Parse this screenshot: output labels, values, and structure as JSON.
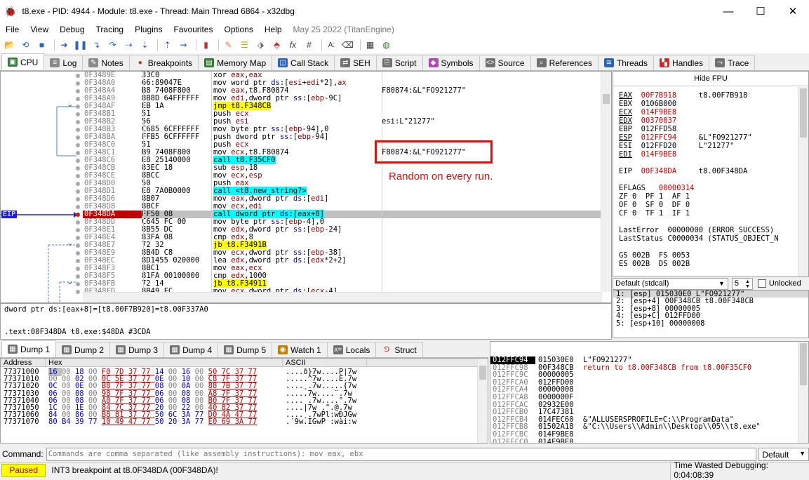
{
  "window": {
    "title": "t8.exe - PID: 4944 - Module: t8.exe - Thread: Main Thread 6864 - x32dbg"
  },
  "menu": [
    "File",
    "View",
    "Debug",
    "Tracing",
    "Plugins",
    "Favourites",
    "Options",
    "Help"
  ],
  "menu_date": "May 25 2022 (TitanEngine)",
  "tabs": [
    {
      "label": "CPU",
      "icon": "cpu-icon",
      "color": "#3a7a3a"
    },
    {
      "label": "Log",
      "icon": "log-icon",
      "color": "#6b6b6b"
    },
    {
      "label": "Notes",
      "icon": "notes-icon",
      "color": "#6b6b6b"
    },
    {
      "label": "Breakpoints",
      "icon": "breakpoint-icon",
      "color": "#d02020"
    },
    {
      "label": "Memory Map",
      "icon": "memory-map-icon",
      "color": "#2f7a2f"
    },
    {
      "label": "Call Stack",
      "icon": "call-stack-icon",
      "color": "#2a63b8"
    },
    {
      "label": "SEH",
      "icon": "seh-icon",
      "color": "#555"
    },
    {
      "label": "Script",
      "icon": "script-icon",
      "color": "#555"
    },
    {
      "label": "Symbols",
      "icon": "symbols-icon",
      "color": "#b04ab0"
    },
    {
      "label": "Source",
      "icon": "source-icon",
      "color": "#555"
    },
    {
      "label": "References",
      "icon": "references-icon",
      "color": "#555"
    },
    {
      "label": "Threads",
      "icon": "threads-icon",
      "color": "#2a63b8"
    },
    {
      "label": "Handles",
      "icon": "handles-icon",
      "color": "#c03030"
    },
    {
      "label": "Trace",
      "icon": "trace-icon",
      "color": "#555"
    }
  ],
  "disasm": [
    {
      "addr": "0F3489E",
      "bytes": "33C0",
      "instr": "xor eax,eax",
      "cmt": "",
      "kind": ""
    },
    {
      "addr": "0F348A0",
      "bytes": "66:89047E",
      "instr": "mov word ptr ds:[esi+edi*2],ax",
      "cmt": "",
      "kind": ""
    },
    {
      "addr": "0F348A4",
      "bytes": "B8 7408F800",
      "instr": "mov eax,t8.F80874",
      "cmt": "F80874:&L\"FO921277\"",
      "kind": ""
    },
    {
      "addr": "0F348A9",
      "bytes": "8B8D 64FFFFFF",
      "instr": "mov edi,dword ptr ss:[ebp-9C]",
      "cmt": "",
      "kind": ""
    },
    {
      "addr": "0F348AF",
      "bytes": "EB 1A",
      "instr": "jmp t8.F348CB",
      "cmt": "",
      "kind": "jmp"
    },
    {
      "addr": "0F348B1",
      "bytes": "51",
      "instr": "push ecx",
      "cmt": "",
      "kind": ""
    },
    {
      "addr": "0F348B2",
      "bytes": "56",
      "instr": "push esi",
      "cmt": "esi:L\"21277\"",
      "kind": ""
    },
    {
      "addr": "0F348B3",
      "bytes": "C685 6CFFFFFF",
      "instr": "mov byte ptr ss:[ebp-94],0",
      "cmt": "",
      "kind": ""
    },
    {
      "addr": "0F348BA",
      "bytes": "FFB5 6CFFFFFF",
      "instr": "push dword ptr ss:[ebp-94]",
      "cmt": "",
      "kind": ""
    },
    {
      "addr": "0F348C0",
      "bytes": "51",
      "instr": "push ecx",
      "cmt": "",
      "kind": ""
    },
    {
      "addr": "0F348C1",
      "bytes": "B9 7408F800",
      "instr": "mov ecx,t8.F80874",
      "cmt": "F80874:&L\"FO921277\"",
      "kind": ""
    },
    {
      "addr": "0F348C6",
      "bytes": "E8 25140000",
      "instr": "call t8.F35CF0",
      "cmt": "",
      "kind": "call"
    },
    {
      "addr": "0F348CB",
      "bytes": "83EC 18",
      "instr": "sub esp,18",
      "cmt": "",
      "kind": ""
    },
    {
      "addr": "0F348CE",
      "bytes": "8BCC",
      "instr": "mov ecx,esp",
      "cmt": "",
      "kind": ""
    },
    {
      "addr": "0F348D0",
      "bytes": "50",
      "instr": "push eax",
      "cmt": "",
      "kind": ""
    },
    {
      "addr": "0F348D1",
      "bytes": "E8 7A0B0000",
      "instr": "call <t8.new_string?>",
      "cmt": "",
      "kind": "call"
    },
    {
      "addr": "0F348D6",
      "bytes": "8B07",
      "instr": "mov eax,dword ptr ds:[edi]",
      "cmt": "",
      "kind": ""
    },
    {
      "addr": "0F348D8",
      "bytes": "8BCF",
      "instr": "mov ecx,edi",
      "cmt": "",
      "kind": ""
    },
    {
      "addr": "0F348DA",
      "bytes": "FF50 08",
      "instr": "call dword ptr ds:[eax+8]",
      "cmt": "",
      "kind": "call",
      "sel": true
    },
    {
      "addr": "0F348DD",
      "bytes": "C645 FC 00",
      "instr": "mov byte ptr ss:[ebp-4],0",
      "cmt": "",
      "kind": ""
    },
    {
      "addr": "0F348E1",
      "bytes": "8B55 DC",
      "instr": "mov edx,dword ptr ss:[ebp-24]",
      "cmt": "",
      "kind": ""
    },
    {
      "addr": "0F348E4",
      "bytes": "83FA 08",
      "instr": "cmp edx,8",
      "cmt": "",
      "kind": ""
    },
    {
      "addr": "0F348E7",
      "bytes": "72 32",
      "instr": "jb t8.F3491B",
      "cmt": "",
      "kind": "jmp"
    },
    {
      "addr": "0F348E9",
      "bytes": "8B4D C8",
      "instr": "mov ecx,dword ptr ss:[ebp-38]",
      "cmt": "",
      "kind": ""
    },
    {
      "addr": "0F348EC",
      "bytes": "8D1455 020000",
      "instr": "lea edx,dword ptr ds:[edx*2+2]",
      "cmt": "",
      "kind": ""
    },
    {
      "addr": "0F348F3",
      "bytes": "8BC1",
      "instr": "mov eax,ecx",
      "cmt": "",
      "kind": ""
    },
    {
      "addr": "0F348F5",
      "bytes": "81FA 00100000",
      "instr": "cmp edx,1000",
      "cmt": "",
      "kind": ""
    },
    {
      "addr": "0F348FB",
      "bytes": "72 14",
      "instr": "jb t8.F34911",
      "cmt": "",
      "kind": "jmp"
    },
    {
      "addr": "0F348FD",
      "bytes": "8B49 FC",
      "instr": "mov ecx,dword ptr ds:[ecx-4]",
      "cmt": "",
      "kind": ""
    }
  ],
  "eip_label": "EIP",
  "annotation": "Random on every run.",
  "info_line1": "dword ptr ds:[eax+8]=[t8.00F7B920]=t8.00F337A0",
  "info_line2": ".text:00F348DA t8.exe:$48DA #3CDA",
  "fpu_button": "Hide FPU",
  "registers": [
    {
      "name": "EAX",
      "val": "00F7B918",
      "ann": "t8.00F7B918",
      "hl": true
    },
    {
      "name": "EBX",
      "val": "0106B000",
      "ann": "",
      "hl": false
    },
    {
      "name": "ECX",
      "val": "014F9BE8",
      "ann": "",
      "hl": true
    },
    {
      "name": "EDX",
      "val": "00370037",
      "ann": "",
      "hl": true
    },
    {
      "name": "EBP",
      "val": "012FFD58",
      "ann": "",
      "hl": false
    },
    {
      "name": "ESP",
      "val": "012FFC94",
      "ann": "&L\"FO921277\"",
      "hl": true
    },
    {
      "name": "ESI",
      "val": "012FFD20",
      "ann": "L\"21277\"",
      "hl": false
    },
    {
      "name": "EDI",
      "val": "014F9BE8",
      "ann": "",
      "hl": true
    }
  ],
  "eip_reg": {
    "name": "EIP",
    "val": "00F348DA",
    "ann": "t8.00F348DA"
  },
  "eflags": {
    "name": "EFLAGS",
    "val": "00000314"
  },
  "flags": [
    "ZF 0  PF 1  AF 1",
    "OF 0  SF 0  DF 0",
    "CF 0  TF 1  IF 1"
  ],
  "lasterror": "LastError  00000000 (ERROR_SUCCESS)",
  "laststatus": "LastStatus C0000034 (STATUS_OBJECT_N",
  "segs": [
    "GS 002B  FS 0053",
    "ES 002B  DS 002B"
  ],
  "callconv": {
    "value": "Default (stdcall)",
    "count": "5",
    "unlocked_label": "Unlocked"
  },
  "args": [
    "1: [esp] 015030E0 L\"FO921277\"",
    "2: [esp+4] 00F348CB t8.00F348CB",
    "3: [esp+8] 00000005",
    "4: [esp+C] 012FFD00",
    "5: [esp+10] 00000008"
  ],
  "dump_tabs": [
    "Dump 1",
    "Dump 2",
    "Dump 3",
    "Dump 4",
    "Dump 5",
    "Watch 1",
    "Locals",
    "Struct"
  ],
  "dump_headers": [
    "Address",
    "Hex",
    "ASCII"
  ],
  "dump_rows": [
    {
      "addr": "77371000",
      "hex": "16 00 18 00 F0 7D 37 77 14 00 16 00 50 7C 37 77",
      "ascii": "....ð}7w....P|7w"
    },
    {
      "addr": "77371010",
      "hex": "00 00 02 00 0C 5E 37 77 0E 00 10 00 C8 7F 37 77",
      "ascii": ".....^7w....È.7w"
    },
    {
      "addr": "77371020",
      "hex": "0C 00 0E 00 B8 7F 37 77 08 00 0A 00 88 7B 37 77",
      "ascii": "....¸.7w.....{7w"
    },
    {
      "addr": "77371030",
      "hex": "06 00 08 00 98 7F 37 77 06 00 08 00 A8 7F 37 77",
      "ascii": ".....7w....¨.7w"
    },
    {
      "addr": "77371040",
      "hex": "06 00 08 00 A0 7F 37 77 06 00 08 00 B0 7F 37 77",
      "ascii": ".... .7w....°.7w"
    },
    {
      "addr": "77371050",
      "hex": "1C 00 1E 00 84 7C 37 77 20 00 22 00 40 82 37 77",
      "ascii": "....|7w .\".@.7w"
    },
    {
      "addr": "77371060",
      "hex": "84 00 86 00 B8 81 37 77 50 6C 3A 77 D0 4A 47 77",
      "ascii": "....¸.7wPl:wÐJGw"
    },
    {
      "addr": "77371070",
      "hex": "80 B4 39 77 10 49 47 77 50 20 3A 77 E0 69 3A 77",
      "ascii": ".´9w.IGwP :wài:w"
    }
  ],
  "stack_rows": [
    {
      "addr": "012FFC94",
      "val": "015030E0",
      "cmt": "L\"FO921277\"",
      "sel": true,
      "red": false
    },
    {
      "addr": "012FFC98",
      "val": "00F348CB",
      "cmt": "return to t8.00F348CB from t8.00F35CF0",
      "sel": false,
      "red": true
    },
    {
      "addr": "012FFC9C",
      "val": "00000005",
      "cmt": "",
      "sel": false,
      "red": false
    },
    {
      "addr": "012FFCA0",
      "val": "012FFD00",
      "cmt": "",
      "sel": false,
      "red": false
    },
    {
      "addr": "012FFCA4",
      "val": "00000008",
      "cmt": "",
      "sel": false,
      "red": false
    },
    {
      "addr": "012FFCA8",
      "val": "0000000F",
      "cmt": "",
      "sel": false,
      "red": false
    },
    {
      "addr": "012FFCAC",
      "val": "02932E00",
      "cmt": "",
      "sel": false,
      "red": false
    },
    {
      "addr": "012FFCB0",
      "val": "17C47381",
      "cmt": "",
      "sel": false,
      "red": false
    },
    {
      "addr": "012FFCB4",
      "val": "014FEC60",
      "cmt": "&\"ALLUSERSPROFILE=C:\\\\ProgramData\"",
      "sel": false,
      "red": false
    },
    {
      "addr": "012FFCB8",
      "val": "01502A18",
      "cmt": "&\"C:\\\\Users\\\\Admin\\\\Desktop\\\\05\\\\t8.exe\"",
      "sel": false,
      "red": false
    },
    {
      "addr": "012FFCBC",
      "val": "014F9BE8",
      "cmt": "",
      "sel": false,
      "red": false
    },
    {
      "addr": "012FFCC0",
      "val": "014F9BE8",
      "cmt": "",
      "sel": false,
      "red": false
    }
  ],
  "command": {
    "label": "Command:",
    "placeholder": "Commands are comma separated (like assembly instructions): mov eax, ebx",
    "engine": "Default"
  },
  "status": {
    "state": "Paused",
    "message": "INT3 breakpoint at t8.0F348DA (00F348DA)!",
    "time": "Time Wasted Debugging: 0:04:08:39"
  }
}
